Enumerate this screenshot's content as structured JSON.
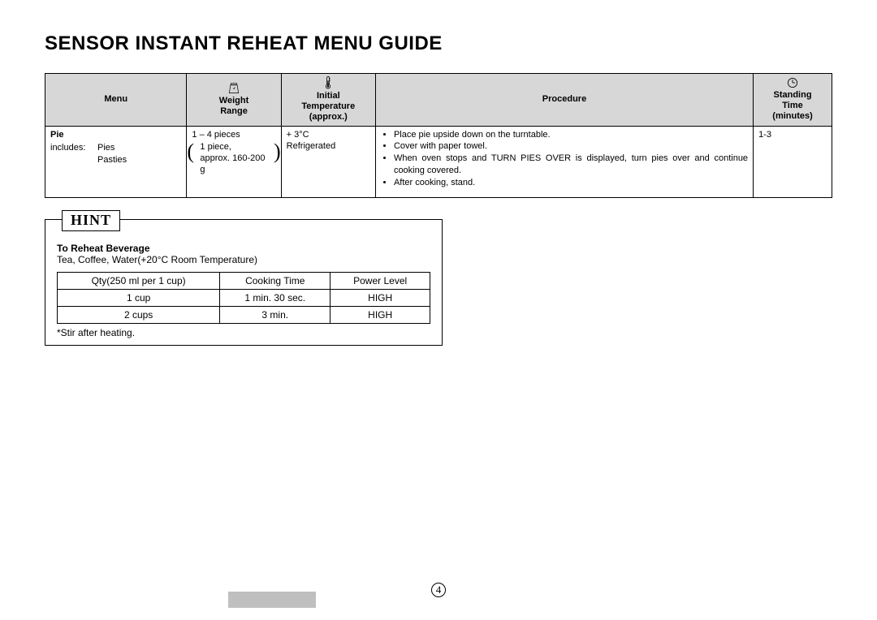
{
  "title": "SENSOR INSTANT REHEAT MENU GUIDE",
  "main_table": {
    "headers": {
      "menu": "Menu",
      "weight": "Weight\nRange",
      "temp": "Initial\nTemperature\n(approx.)",
      "proc": "Procedure",
      "stand": "Standing\nTime\n(minutes)"
    },
    "row": {
      "menu_label": "Pie",
      "includes_label": "includes:",
      "includes_items": "Pies\nPasties",
      "weight_line1": "1 – 4 pieces",
      "weight_paren1": "1 piece,",
      "weight_paren2": "approx. 160-200 g",
      "temp_line1": "+ 3°C",
      "temp_line2": "Refrigerated",
      "proc1": "Place pie upside down on the turntable.",
      "proc2": "Cover with paper towel.",
      "proc3": "When oven stops and TURN PIES OVER is displayed, turn pies over and continue cooking covered.",
      "proc4": "After cooking, stand.",
      "stand": "1-3"
    }
  },
  "hint": {
    "tab": "HINT",
    "heading": "To Reheat Beverage",
    "sub": "Tea, Coffee, Water(+20°C Room Temperature)",
    "columns": {
      "qty": "Qty(250 ml per 1 cup)",
      "time": "Cooking Time",
      "power": "Power Level"
    },
    "rows": [
      {
        "qty": "1 cup",
        "time": "1 min. 30 sec.",
        "power": "HIGH"
      },
      {
        "qty": "2 cups",
        "time": "3 min.",
        "power": "HIGH"
      }
    ],
    "note": "*Stir after heating."
  },
  "page_number": "4"
}
